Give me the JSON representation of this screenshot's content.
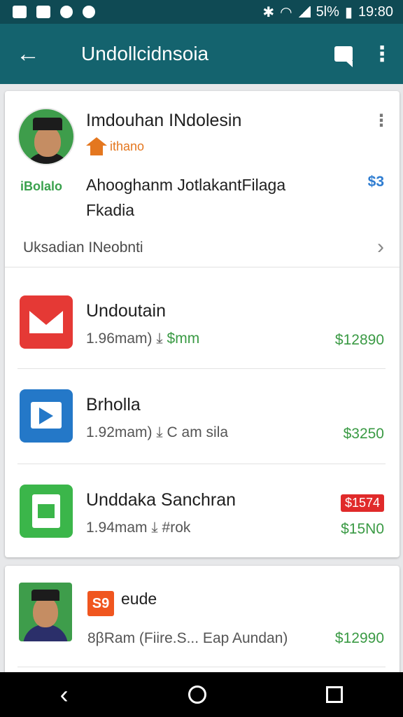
{
  "status": {
    "battery": "5l%",
    "time": "19:80"
  },
  "app_bar": {
    "title": "Undollcidnsoia"
  },
  "profile": {
    "name": "Imdouhan INdolesin",
    "home_label": "ithano",
    "brand": {
      "prefix": "iBo",
      "suffix": "lalo"
    },
    "desc_line1": "Ahooghanm JotlakantFilaga",
    "desc_line2": "Fkadia",
    "price": "$3"
  },
  "link_row": {
    "label": "Uksadian INeobnti"
  },
  "apps": [
    {
      "title": "Undoutain",
      "meta": "1.96mam)",
      "meta_suffix": "$mm",
      "price": "$12890",
      "icon": "mail-icon"
    },
    {
      "title": "Brholla",
      "meta": "1.92mam)",
      "meta_suffix": "C am sila",
      "price": "$3250",
      "icon": "card-icon"
    },
    {
      "title": "Unddaka Sanchran",
      "meta": "1.94mam",
      "meta_suffix": "#rok",
      "price": "$15N0",
      "price_top": "$1574",
      "icon": "doc-icon"
    }
  ],
  "card2": {
    "badge": "S9",
    "title": "eude",
    "meta": "8βRam (Fiire.S...  Eap Aundan)",
    "price": "$12990"
  },
  "colors": {
    "status_bar": "#0f4a54",
    "app_bar": "#14636e",
    "price_green": "#3a9a44",
    "accent_orange": "#e4771f"
  }
}
